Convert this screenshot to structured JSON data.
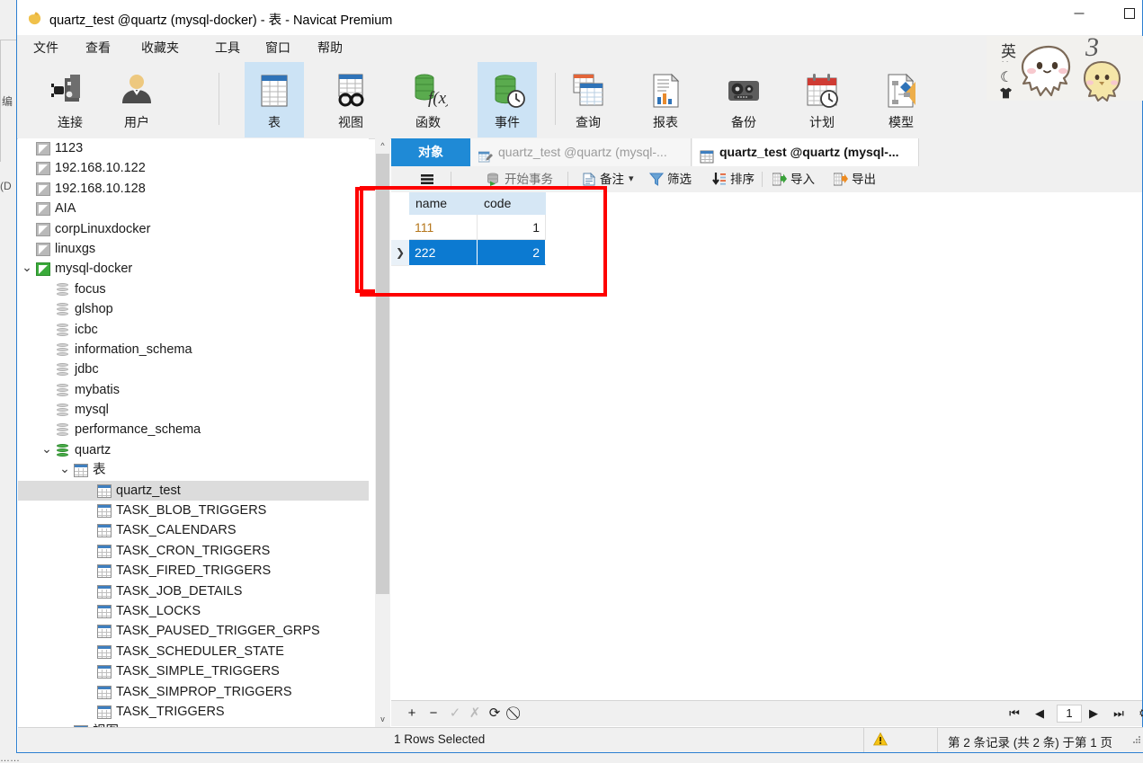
{
  "window": {
    "title": "quartz_test @quartz (mysql-docker) - 表 - Navicat Premium",
    "app_icon": "navicat-logo-icon",
    "minimize_label": "—",
    "maximize_label": "□"
  },
  "menubar": {
    "items": [
      {
        "label": "文件",
        "name": "menu-file"
      },
      {
        "label": "查看",
        "name": "menu-view"
      },
      {
        "label": "收藏夹",
        "name": "menu-favorites"
      },
      {
        "label": "工具",
        "name": "menu-tools"
      },
      {
        "label": "窗口",
        "name": "menu-window"
      },
      {
        "label": "帮助",
        "name": "menu-help"
      }
    ]
  },
  "toolbar": {
    "items": [
      {
        "label": "连接",
        "icon": "connection-icon",
        "name": "toolbar-connection",
        "selected": false,
        "has_caret": true
      },
      {
        "label": "用户",
        "icon": "user-icon",
        "name": "toolbar-user",
        "selected": false,
        "has_caret": false
      },
      {
        "label": "表",
        "icon": "table-icon",
        "name": "toolbar-table",
        "selected": true,
        "has_caret": false
      },
      {
        "label": "视图",
        "icon": "view-icon",
        "name": "toolbar-view",
        "selected": false,
        "has_caret": false
      },
      {
        "label": "函数",
        "icon": "function-icon",
        "name": "toolbar-function",
        "selected": false,
        "has_caret": false
      },
      {
        "label": "事件",
        "icon": "event-icon",
        "name": "toolbar-event",
        "selected": true,
        "has_caret": false
      },
      {
        "label": "查询",
        "icon": "query-icon",
        "name": "toolbar-query",
        "selected": false,
        "has_caret": false
      },
      {
        "label": "报表",
        "icon": "report-icon",
        "name": "toolbar-report",
        "selected": false,
        "has_caret": false
      },
      {
        "label": "备份",
        "icon": "backup-icon",
        "name": "toolbar-backup",
        "selected": false,
        "has_caret": false
      },
      {
        "label": "计划",
        "icon": "schedule-icon",
        "name": "toolbar-schedule",
        "selected": false,
        "has_caret": false
      },
      {
        "label": "模型",
        "icon": "model-icon",
        "name": "toolbar-model",
        "selected": false,
        "has_caret": false
      }
    ]
  },
  "ime": {
    "mode": "英",
    "dots": "˙˙",
    "moon": "☾",
    "shirt": "👕",
    "badge": "3"
  },
  "background_window": {
    "left_text": "编",
    "left_text2": "(D",
    "bottom_text": "……"
  },
  "sidebar": {
    "nodes": [
      {
        "label": "1123",
        "icon": "connection-closed-icon",
        "indent": 0,
        "expander": "",
        "selected": false
      },
      {
        "label": "192.168.10.122",
        "icon": "connection-closed-icon",
        "indent": 0,
        "expander": "",
        "selected": false
      },
      {
        "label": "192.168.10.128",
        "icon": "connection-closed-icon",
        "indent": 0,
        "expander": "",
        "selected": false
      },
      {
        "label": "AIA",
        "icon": "connection-closed-icon",
        "indent": 0,
        "expander": "",
        "selected": false
      },
      {
        "label": "corpLinuxdocker",
        "icon": "connection-closed-icon",
        "indent": 0,
        "expander": "",
        "selected": false
      },
      {
        "label": "linuxgs",
        "icon": "connection-closed-icon",
        "indent": 0,
        "expander": "",
        "selected": false
      },
      {
        "label": "mysql-docker",
        "icon": "connection-open-icon",
        "indent": 0,
        "expander": "v",
        "selected": false
      },
      {
        "label": "focus",
        "icon": "database-icon",
        "indent": 1,
        "expander": "",
        "selected": false
      },
      {
        "label": "glshop",
        "icon": "database-icon",
        "indent": 1,
        "expander": "",
        "selected": false
      },
      {
        "label": "icbc",
        "icon": "database-icon",
        "indent": 1,
        "expander": "",
        "selected": false
      },
      {
        "label": "information_schema",
        "icon": "database-icon",
        "indent": 1,
        "expander": "",
        "selected": false
      },
      {
        "label": "jdbc",
        "icon": "database-icon",
        "indent": 1,
        "expander": "",
        "selected": false
      },
      {
        "label": "mybatis",
        "icon": "database-icon",
        "indent": 1,
        "expander": "",
        "selected": false
      },
      {
        "label": "mysql",
        "icon": "database-icon",
        "indent": 1,
        "expander": "",
        "selected": false
      },
      {
        "label": "performance_schema",
        "icon": "database-icon",
        "indent": 1,
        "expander": "",
        "selected": false
      },
      {
        "label": "quartz",
        "icon": "database-open-icon",
        "indent": 1,
        "expander": "v",
        "selected": false
      },
      {
        "label": "表",
        "icon": "table-folder-icon",
        "indent": 2,
        "expander": "v",
        "selected": false
      },
      {
        "label": "quartz_test",
        "icon": "table-icon",
        "indent": 3,
        "expander": "",
        "selected": true
      },
      {
        "label": "TASK_BLOB_TRIGGERS",
        "icon": "table-icon",
        "indent": 3,
        "expander": "",
        "selected": false
      },
      {
        "label": "TASK_CALENDARS",
        "icon": "table-icon",
        "indent": 3,
        "expander": "",
        "selected": false
      },
      {
        "label": "TASK_CRON_TRIGGERS",
        "icon": "table-icon",
        "indent": 3,
        "expander": "",
        "selected": false
      },
      {
        "label": "TASK_FIRED_TRIGGERS",
        "icon": "table-icon",
        "indent": 3,
        "expander": "",
        "selected": false
      },
      {
        "label": "TASK_JOB_DETAILS",
        "icon": "table-icon",
        "indent": 3,
        "expander": "",
        "selected": false
      },
      {
        "label": "TASK_LOCKS",
        "icon": "table-icon",
        "indent": 3,
        "expander": "",
        "selected": false
      },
      {
        "label": "TASK_PAUSED_TRIGGER_GRPS",
        "icon": "table-icon",
        "indent": 3,
        "expander": "",
        "selected": false
      },
      {
        "label": "TASK_SCHEDULER_STATE",
        "icon": "table-icon",
        "indent": 3,
        "expander": "",
        "selected": false
      },
      {
        "label": "TASK_SIMPLE_TRIGGERS",
        "icon": "table-icon",
        "indent": 3,
        "expander": "",
        "selected": false
      },
      {
        "label": "TASK_SIMPROP_TRIGGERS",
        "icon": "table-icon",
        "indent": 3,
        "expander": "",
        "selected": false
      },
      {
        "label": "TASK_TRIGGERS",
        "icon": "table-icon",
        "indent": 3,
        "expander": "",
        "selected": false
      },
      {
        "label": "视图",
        "icon": "view-folder-icon",
        "indent": 2,
        "expander": "",
        "selected": false
      }
    ],
    "scroll_up": "^",
    "scroll_down": "v"
  },
  "tabs": [
    {
      "label": "对象",
      "name": "tab-objects",
      "style": "active",
      "icon": ""
    },
    {
      "label": "quartz_test @quartz (mysql-...",
      "name": "tab-designer",
      "style": "plain",
      "icon": "designer-icon"
    },
    {
      "label": "quartz_test @quartz (mysql-...",
      "name": "tab-data",
      "style": "cur",
      "icon": "table-icon"
    }
  ],
  "grid_toolbar": {
    "items": [
      {
        "label": "",
        "icon": "grid-menu-icon",
        "name": "grid-menu-button"
      },
      {
        "label": "开始事务",
        "icon": "begin-transaction-icon",
        "name": "begin-transaction-button"
      },
      {
        "label": "备注",
        "icon": "note-icon",
        "name": "note-button"
      },
      {
        "label": "筛选",
        "icon": "filter-icon",
        "name": "filter-button"
      },
      {
        "label": "排序",
        "icon": "sort-icon",
        "name": "sort-button"
      },
      {
        "label": "导入",
        "icon": "import-icon",
        "name": "import-button"
      },
      {
        "label": "导出",
        "icon": "export-icon",
        "name": "export-button"
      }
    ],
    "caret": "▾"
  },
  "grid": {
    "columns": [
      "name",
      "code"
    ],
    "rows": [
      {
        "cells": [
          "111",
          "1"
        ],
        "selected": false,
        "indicator": ""
      },
      {
        "cells": [
          "222",
          "2"
        ],
        "selected": true,
        "indicator": "❯"
      }
    ]
  },
  "nav": {
    "first": "⏮",
    "prev": "◀",
    "page": "1",
    "next": "▶",
    "last": "⏭",
    "settings": "⚙",
    "add": "+",
    "remove": "−",
    "apply": "✓",
    "cancel": "✗",
    "refresh": "⟳",
    "stop": "⃠"
  },
  "status": {
    "left": "1 Rows Selected",
    "warn_icon": "warning-icon",
    "right": "第 2 条记录 (共 2 条) 于第 1 页"
  }
}
